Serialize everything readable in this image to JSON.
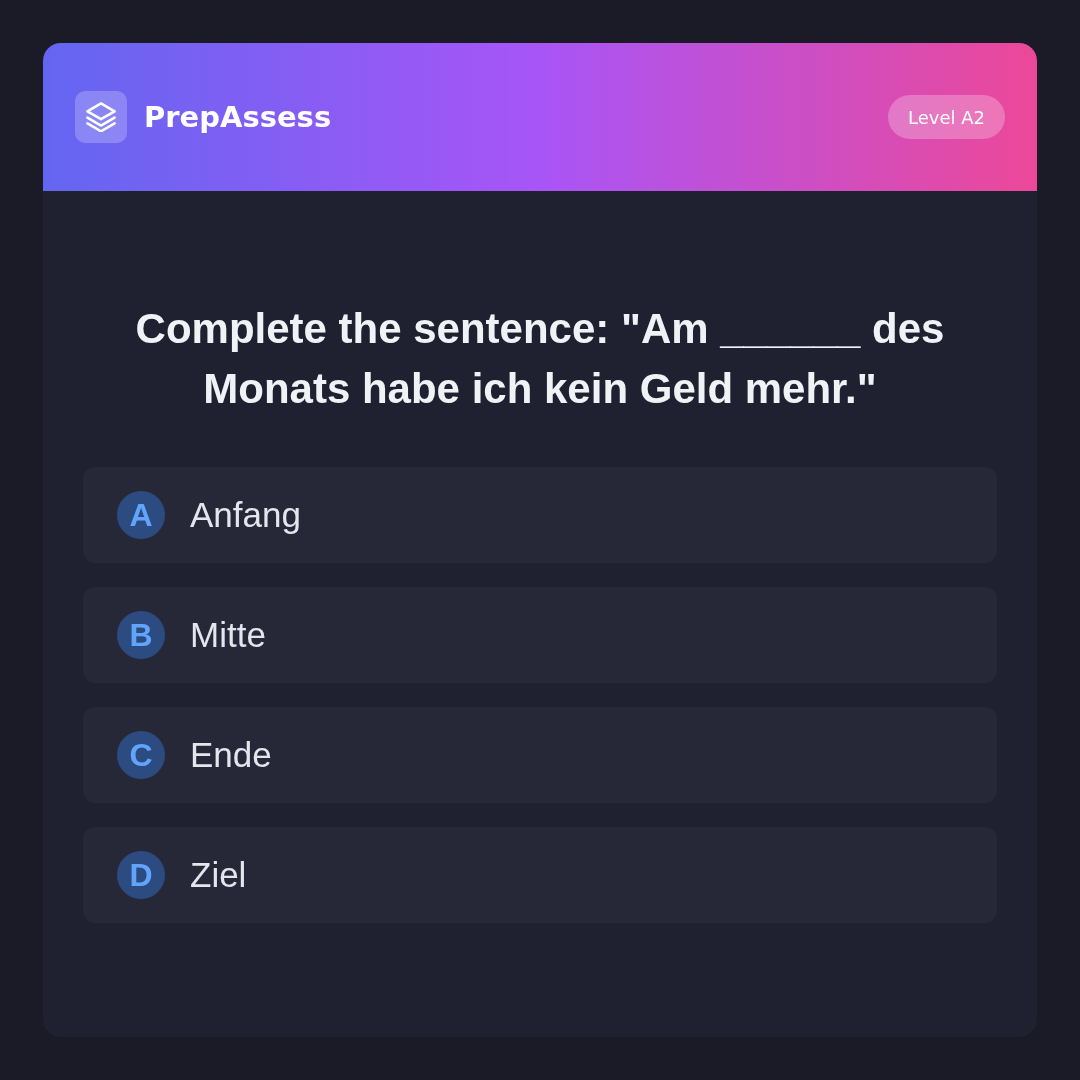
{
  "header": {
    "brand": "PrepAssess",
    "level_badge": "Level A2"
  },
  "question": "Complete the sentence: \"Am ______ des Monats habe ich kein Geld mehr.\"",
  "options": [
    {
      "letter": "A",
      "text": "Anfang",
      "selected": false
    },
    {
      "letter": "B",
      "text": "Mitte",
      "selected": false
    },
    {
      "letter": "C",
      "text": "Ende",
      "selected": false
    },
    {
      "letter": "D",
      "text": "Ziel",
      "selected": false
    }
  ]
}
